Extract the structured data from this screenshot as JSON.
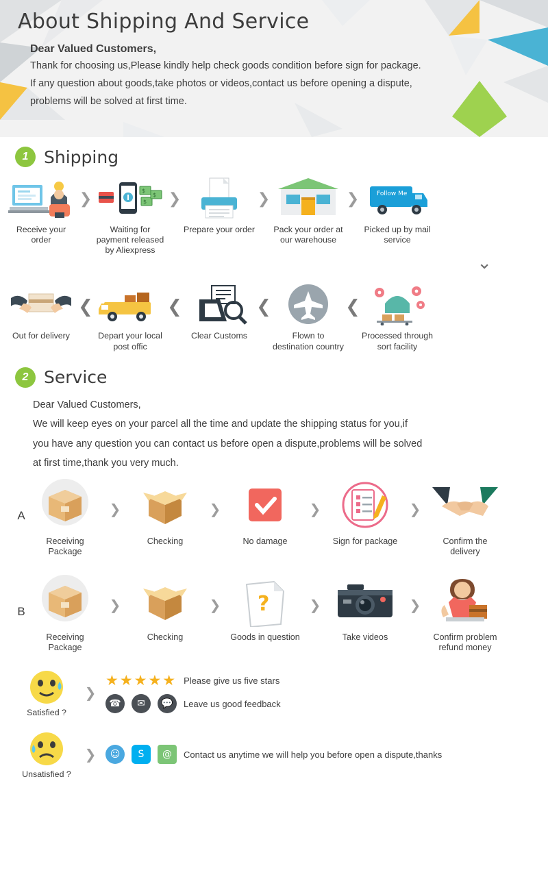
{
  "header": {
    "title": "About Shipping And Service",
    "greeting": "Dear Valued Customers,",
    "lines": [
      "Thank for choosing us,Please kindly help check goods condition before sign for package.",
      "If any question about goods,take photos or videos,contact us before opening a dispute,",
      "problems will be solved at first time."
    ]
  },
  "sections": {
    "shipping": {
      "badge": "1",
      "title": "Shipping"
    },
    "service": {
      "badge": "2",
      "title": "Service"
    }
  },
  "shipping": {
    "row1": [
      {
        "caption": "Receive your order",
        "icon": "desk-computer-icon"
      },
      {
        "caption": "Waiting for payment released by Aliexpress",
        "icon": "mobile-payment-icon"
      },
      {
        "caption": "Prepare your order",
        "icon": "printer-icon"
      },
      {
        "caption": "Pack your order at our warehouse",
        "icon": "warehouse-icon"
      },
      {
        "caption": "Picked up by mail service",
        "icon": "delivery-truck-blue-icon"
      }
    ],
    "row1_arrow": "❯",
    "turn_arrow": "⌄",
    "row2": [
      {
        "caption": "Out for delivery",
        "icon": "package-hands-icon"
      },
      {
        "caption": "Depart your local post offic",
        "icon": "yellow-truck-icon"
      },
      {
        "caption": "Clear Customs",
        "icon": "customs-documents-icon"
      },
      {
        "caption": "Flown to destination country",
        "icon": "airplane-icon"
      },
      {
        "caption": "Processed through sort facility",
        "icon": "sort-facility-icon"
      }
    ],
    "row2_arrow": "❮"
  },
  "service": {
    "paragraphs": [
      "Dear Valued Customers,",
      "We will keep eyes on your parcel all the time and update the shipping status for you,if",
      "you have any question you can contact us before open a dispute,problems will be solved",
      "at first time,thank you very much."
    ],
    "rowA": {
      "letter": "A",
      "arrow": "❯",
      "steps": [
        {
          "caption": "Receiving Package",
          "icon": "parcel-box-icon"
        },
        {
          "caption": "Checking",
          "icon": "open-box-icon"
        },
        {
          "caption": "No damage",
          "icon": "checkmark-square-icon"
        },
        {
          "caption": "Sign for package",
          "icon": "clipboard-pen-icon"
        },
        {
          "caption": "Confirm the delivery",
          "icon": "handshake-icon"
        }
      ]
    },
    "rowB": {
      "letter": "B",
      "arrow": "❯",
      "steps": [
        {
          "caption": "Receiving Package",
          "icon": "parcel-box-icon"
        },
        {
          "caption": "Checking",
          "icon": "open-box-icon"
        },
        {
          "caption": "Goods in question",
          "icon": "question-document-icon"
        },
        {
          "caption": "Take videos",
          "icon": "camera-icon"
        },
        {
          "caption": "Confirm problem refund money",
          "icon": "customer-service-agent-icon"
        }
      ]
    },
    "feedback": [
      {
        "emoji_icon": "satisfied-face-icon",
        "emoji_caption": "Satisfied ?",
        "arrow": "❯",
        "lines": [
          {
            "type": "stars",
            "stars": "★★★★★",
            "text": "Please give us five stars"
          },
          {
            "type": "contacts",
            "icons": [
              "phone-icon",
              "mail-icon",
              "chat-icon"
            ],
            "text": "Leave us good feedback"
          }
        ]
      },
      {
        "emoji_icon": "unsatisfied-face-icon",
        "emoji_caption": "Unsatisfied ?",
        "arrow": "❯",
        "lines": [
          {
            "type": "contacts",
            "icons": [
              "messenger-icon",
              "skype-icon",
              "email-icon"
            ],
            "text": "Contact us anytime we will help you before open a dispute,thanks"
          }
        ]
      }
    ]
  },
  "colors": {
    "accent_green": "#8dc63f",
    "star_yellow": "#f5b11e",
    "header_bg": "#f2f2f2",
    "text": "#3d3d3d"
  }
}
